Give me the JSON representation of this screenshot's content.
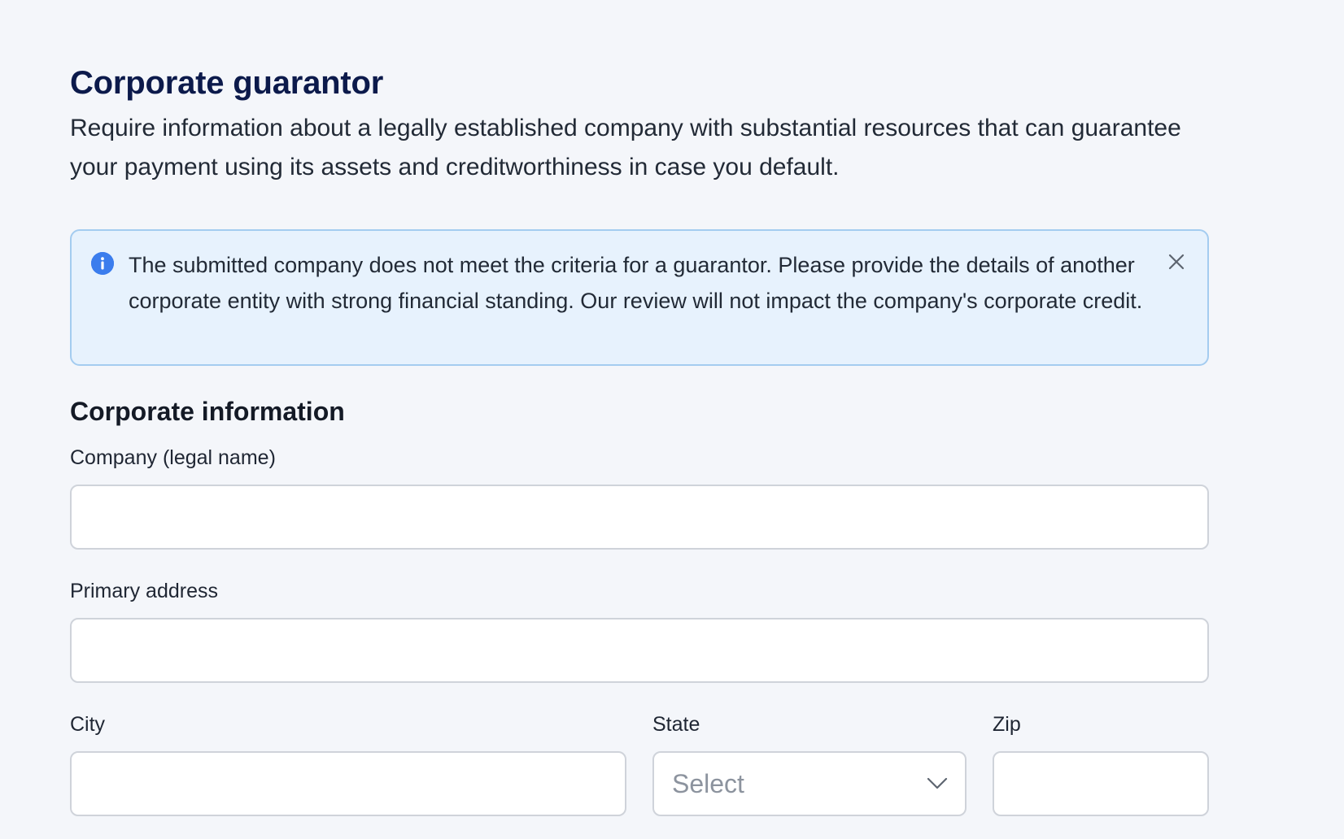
{
  "header": {
    "title": "Corporate guarantor",
    "description": "Require information about a legally established company with substantial resources that can guarantee your payment using its assets and creditworthiness in case you default."
  },
  "alert": {
    "icon": "info-icon",
    "close_icon": "close-icon",
    "message": "The submitted company does not meet the criteria for a guarantor. Please provide the details of another corporate entity with strong financial standing. Our review will not impact the company's corporate credit.",
    "colors": {
      "background": "#e7f2fd",
      "border": "#a4ccf0",
      "icon": "#3b7ded"
    }
  },
  "section": {
    "title": "Corporate information"
  },
  "form": {
    "company": {
      "label": "Company (legal name)",
      "value": ""
    },
    "address": {
      "label": "Primary address",
      "value": ""
    },
    "city": {
      "label": "City",
      "value": ""
    },
    "state": {
      "label": "State",
      "placeholder": "Select",
      "icon": "chevron-down-icon"
    },
    "zip": {
      "label": "Zip",
      "value": ""
    }
  },
  "colors": {
    "title": "#0c1a4b",
    "background": "#f4f6fa"
  }
}
